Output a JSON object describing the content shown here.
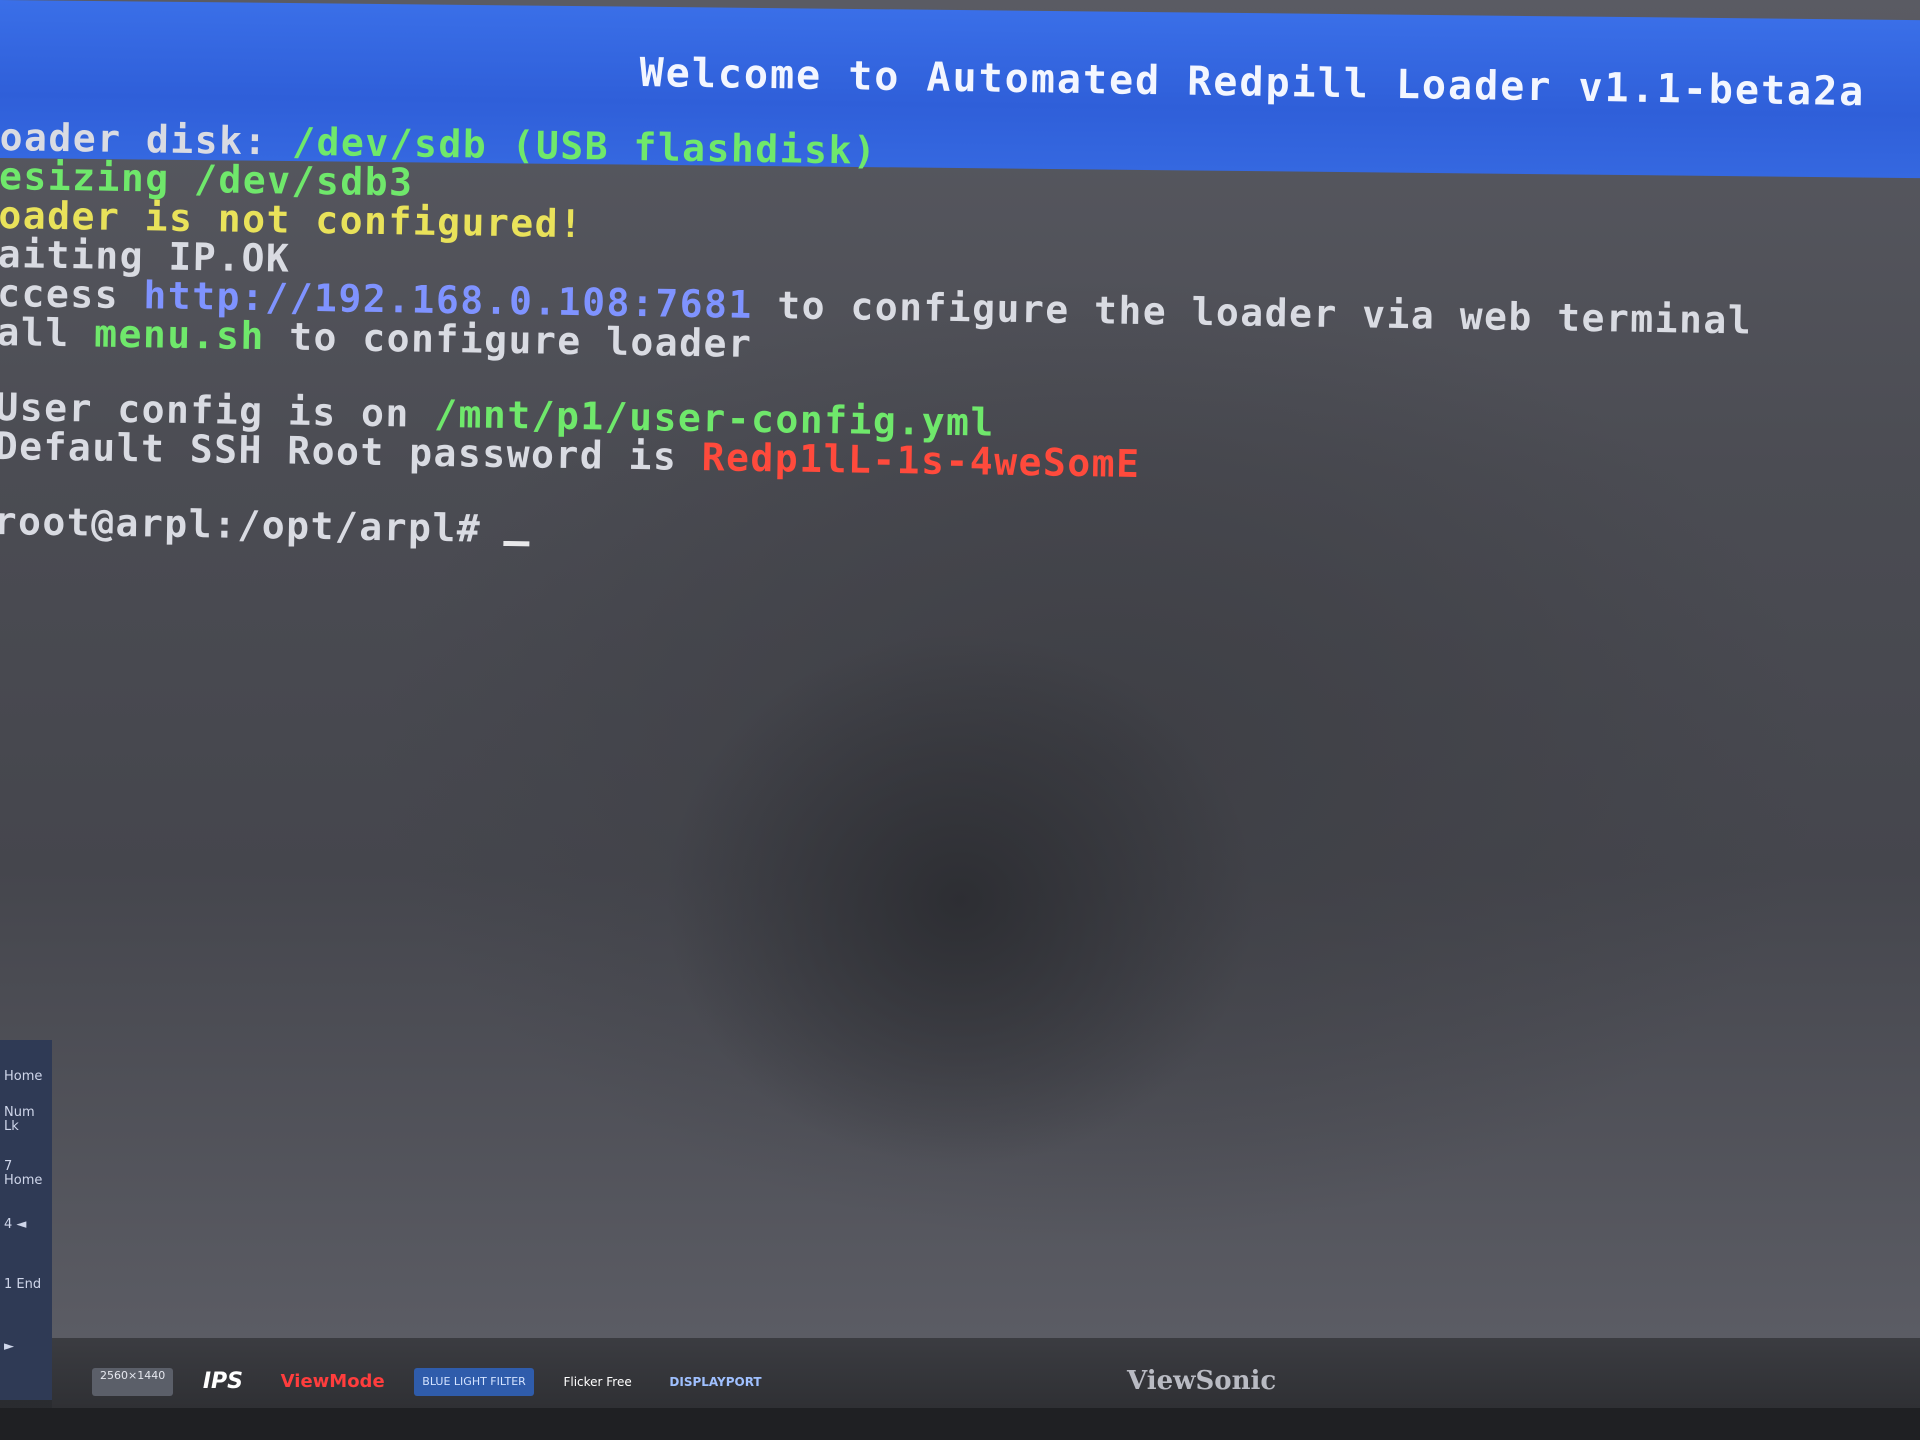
{
  "window": {
    "title": "Welcome to Automated Redpill Loader v1.1-beta2a"
  },
  "terminal": {
    "lines": [
      {
        "segments": [
          {
            "text": "oader disk: ",
            "color": "w"
          },
          {
            "text": "/dev/sdb",
            "color": "g"
          },
          {
            "text": " (USB flashdisk)",
            "color": "g"
          }
        ]
      },
      {
        "segments": [
          {
            "text": "esizing /dev/sdb3",
            "color": "g"
          }
        ]
      },
      {
        "segments": [
          {
            "text": "oader is not configured!",
            "color": "y"
          }
        ]
      },
      {
        "segments": [
          {
            "text": "aiting IP.OK",
            "color": "w"
          }
        ]
      },
      {
        "segments": [
          {
            "text": "ccess ",
            "color": "w"
          },
          {
            "text": "http://192.168.0.108:7681",
            "color": "b"
          },
          {
            "text": " to configure the loader via web terminal",
            "color": "w"
          }
        ]
      },
      {
        "segments": [
          {
            "text": "all ",
            "color": "w"
          },
          {
            "text": "menu.sh",
            "color": "g"
          },
          {
            "text": " to configure loader",
            "color": "w"
          }
        ]
      },
      {
        "segments": []
      },
      {
        "segments": [
          {
            "text": "User config is on ",
            "color": "w"
          },
          {
            "text": "/mnt/p1/user-config.yml",
            "color": "g"
          }
        ]
      },
      {
        "segments": [
          {
            "text": "Default SSH Root password is ",
            "color": "w"
          },
          {
            "text": "Redp1lL-1s-4weSomE",
            "color": "r"
          }
        ]
      },
      {
        "segments": []
      },
      {
        "segments": [
          {
            "text": "root@arpl:/opt/arpl#",
            "color": "w"
          }
        ]
      }
    ],
    "prompt": "root@arpl:/opt/arpl#"
  },
  "keyboard_edge": {
    "keys": [
      "Home",
      "Num Lk",
      "7 Home",
      "4 ◄",
      "1 End",
      "►"
    ]
  },
  "bezel": {
    "badges": [
      "2560×1440",
      "IPS",
      "ViewMode",
      "BLUE LIGHT FILTER",
      "Flicker Free",
      "DISPLAYPORT"
    ],
    "brand": "ViewSonic"
  },
  "colors": {
    "title_bar": "#3568e0",
    "screen": "#4b4c53",
    "white": "#d9dbe2",
    "green": "#6fe86b",
    "yellow": "#e9e25a",
    "blue": "#7f93ff",
    "red": "#ff4a3c"
  }
}
